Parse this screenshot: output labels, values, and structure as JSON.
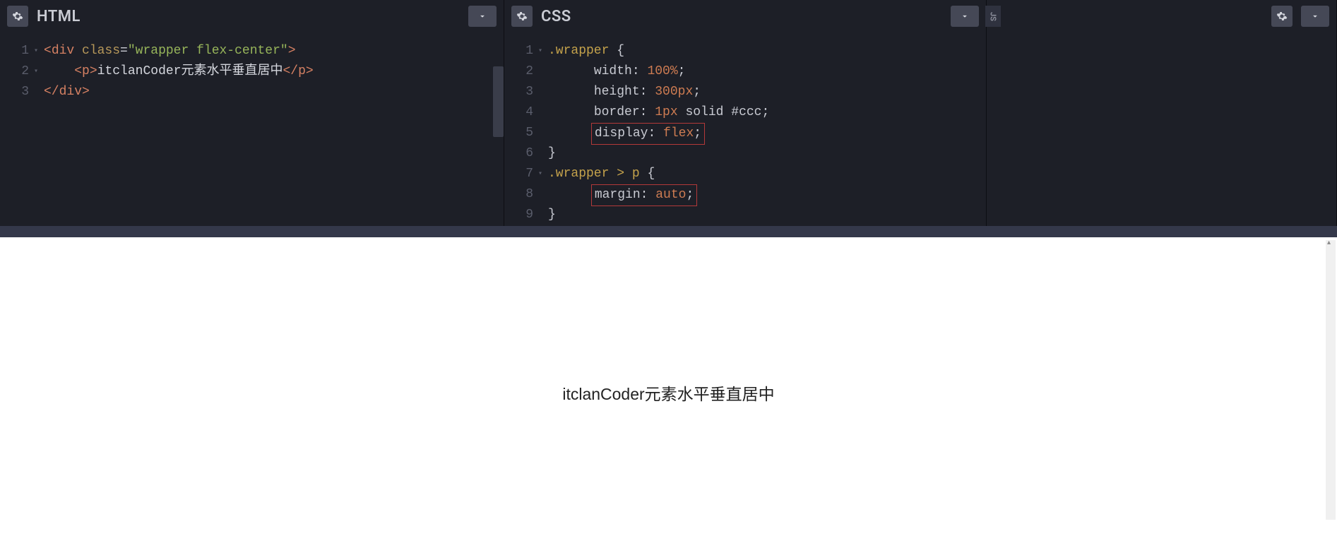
{
  "panes": {
    "html": {
      "title": "HTML"
    },
    "css": {
      "title": "CSS"
    },
    "js": {
      "tab": "JS"
    }
  },
  "html_code": {
    "line_numbers": [
      "1",
      "2",
      "3"
    ],
    "l1": {
      "open": "<",
      "tag": "div",
      "sp": " ",
      "attr": "class",
      "eq": "=",
      "q1": "\"",
      "val": "wrapper flex-center",
      "q2": "\"",
      "close": ">"
    },
    "l2": {
      "indent": "    ",
      "open": "<",
      "tag": "p",
      "close1": ">",
      "text": "itclanCoder元素水平垂直居中",
      "open2": "</",
      "tag2": "p",
      "close2": ">"
    },
    "l3": {
      "open": "</",
      "tag": "div",
      "close": ">"
    }
  },
  "css_code": {
    "line_numbers": [
      "1",
      "2",
      "3",
      "4",
      "5",
      "6",
      "7",
      "8",
      "9"
    ],
    "l1": {
      "sel": ".wrapper",
      "sp": " ",
      "brace": "{"
    },
    "l2": {
      "indent": "      ",
      "prop": "width",
      "colon": ": ",
      "val": "100%",
      "semi": ";"
    },
    "l3": {
      "indent": "      ",
      "prop": "height",
      "colon": ": ",
      "val": "300px",
      "semi": ";"
    },
    "l4": {
      "indent": "      ",
      "prop": "border",
      "colon": ": ",
      "v1": "1px",
      "sp1": " ",
      "v2": "solid",
      "sp2": " ",
      "v3": "#ccc",
      "semi": ";"
    },
    "l5": {
      "indent": "      ",
      "prop": "display",
      "colon": ": ",
      "val": "flex",
      "semi": ";"
    },
    "l6": {
      "brace": "}"
    },
    "l7": {
      "sel": ".wrapper > p",
      "sp": " ",
      "brace": "{"
    },
    "l8": {
      "indent": "      ",
      "prop": "margin",
      "colon": ": ",
      "val": "auto",
      "semi": ";"
    },
    "l9": {
      "brace": "}"
    }
  },
  "preview": {
    "text": "itclanCoder元素水平垂直居中"
  }
}
